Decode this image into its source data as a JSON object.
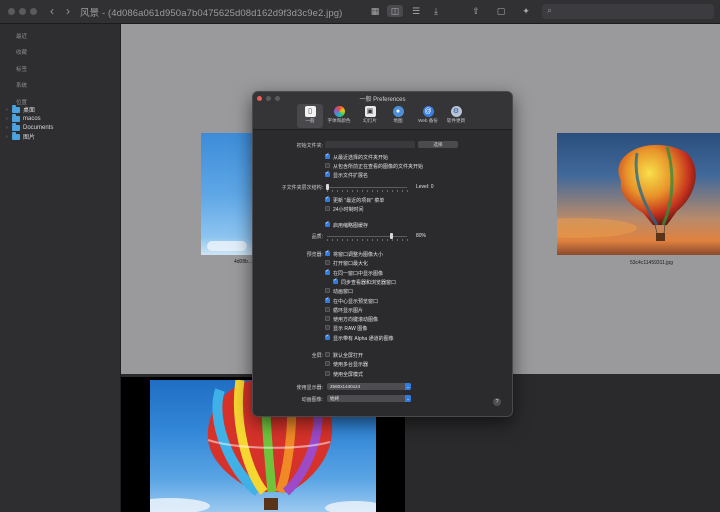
{
  "window": {
    "title": "风景 - (4d086a061d950a7b0475625d08d162d9f3d3c9e2.jpg)",
    "back_glyph": "‹",
    "forward_glyph": "›"
  },
  "toolbar": {
    "icons": [
      "grid-icon",
      "columns-icon",
      "list-icon",
      "download-icon",
      "share-icon",
      "window-icon",
      "info-icon",
      "search-icon"
    ],
    "grid_glyph": "▦",
    "columns_glyph": "◫",
    "list_glyph": "☰",
    "download_glyph": "⤓",
    "share_glyph": "⇪",
    "window_glyph": "▢",
    "info_glyph": "✦",
    "search_glyph": "⌕",
    "search_placeholder": ""
  },
  "sidebar": {
    "sections": [
      "最近",
      "收藏",
      "标签",
      "系统",
      "位置"
    ],
    "items": [
      {
        "label": "桌面"
      },
      {
        "label": "macos"
      },
      {
        "label": "Documents"
      },
      {
        "label": "图片"
      }
    ],
    "chevron": "›"
  },
  "browser": {
    "caption_left": "4d08b...",
    "caption_right": "53c4c11459311.jpg"
  },
  "prefs": {
    "title": "一般 Preferences",
    "tabs": [
      {
        "label": "一般",
        "icon": "general-icon"
      },
      {
        "label": "字体和颜色",
        "icon": "color-wheel-icon"
      },
      {
        "label": "幻灯片",
        "icon": "slideshow-icon"
      },
      {
        "label": "地图",
        "icon": "map-icon"
      },
      {
        "label": "Web 备份",
        "icon": "web-icon"
      },
      {
        "label": "软件更新",
        "icon": "update-icon"
      }
    ],
    "startup_label": "初始文件夹:",
    "startup_button": "选择",
    "startup_checks": [
      {
        "label": "从最近选择的文件夹开始",
        "checked": true
      },
      {
        "label": "从包含所前正在查看的图像的文件夹开始",
        "checked": false
      },
      {
        "label": "显示文件扩展名",
        "checked": true
      }
    ],
    "depth_label": "子文件夹层次结构:",
    "depth_value": "Level: 0",
    "depth_level": 0,
    "recent_checks": [
      {
        "label": "更新 \"最近的项目\" 菜单",
        "checked": true
      },
      {
        "label": "24小时制时间",
        "checked": false
      }
    ],
    "cache_check": {
      "label": "启用缩略图缓存",
      "checked": true
    },
    "quality_label": "品质:",
    "quality_value": "80%",
    "quality_fraction": 0.8,
    "preview_label": "预览器:",
    "preview_checks": [
      {
        "label": "将窗口调整为图像大小",
        "checked": true
      },
      {
        "label": "打开窗口最大化",
        "checked": false
      },
      {
        "label": "在同一窗口中显示图像",
        "checked": true
      },
      {
        "label": "同步查看器和浏览器窗口",
        "checked": true,
        "indent": true
      },
      {
        "label": "动画窗口",
        "checked": false
      },
      {
        "label": "在中心显示预览窗口",
        "checked": true
      },
      {
        "label": "循环显示图片",
        "checked": false
      },
      {
        "label": "使用方向键滚动图像",
        "checked": false
      },
      {
        "label": "显示 RAW 图像",
        "checked": false
      },
      {
        "label": "显示带有 Alpha 通道的图像",
        "checked": true
      }
    ],
    "fullscreen_label": "全屏:",
    "fullscreen_checks": [
      {
        "label": "默认全屏打开",
        "checked": false
      },
      {
        "label": "使用多台显示器",
        "checked": false
      },
      {
        "label": "使用全屏模式",
        "checked": false
      }
    ],
    "display_label": "使用显示器:",
    "display_value": "2560x1440x24",
    "animation_label": "动画图像:",
    "animation_value": "始终",
    "select_arrow": "⌄",
    "help": "?"
  },
  "colors": {
    "accent": "#2f7de1",
    "window_bg": "#2b2a2d",
    "content_bg": "#9a9a9c"
  }
}
